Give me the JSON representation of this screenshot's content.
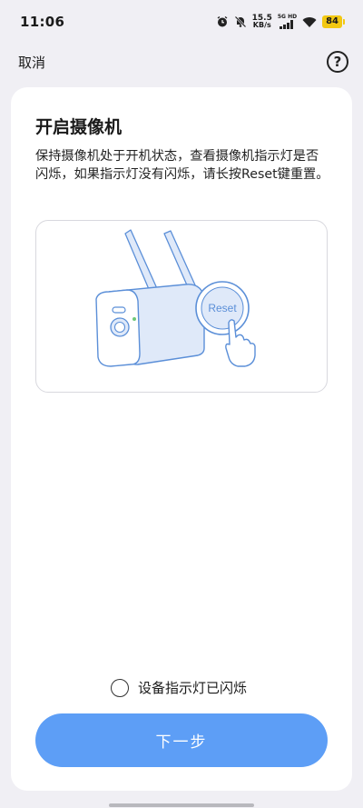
{
  "status_bar": {
    "time": "11:06",
    "net_speed_value": "15.5",
    "net_speed_unit": "KB/s",
    "signal_label": "5G HD",
    "battery": "84",
    "icons": [
      "alarm-icon",
      "mute-icon",
      "signal-icon",
      "wifi-icon",
      "battery-icon"
    ]
  },
  "topbar": {
    "cancel_label": "取消",
    "help_icon": "question-circle-icon",
    "help_glyph": "?"
  },
  "card": {
    "title": "开启摄像机",
    "description": "保持摄像机处于开机状态，查看摄像机指示灯是否闪烁，如果指示灯没有闪烁，请长按Reset键重置。",
    "illustration": {
      "icon": "camera-reset-illustration",
      "reset_text": "Reset"
    },
    "confirm_label": "设备指示灯已闪烁",
    "confirm_checked": false,
    "next_label": "下一步"
  },
  "colors": {
    "accent": "#5d9ef6",
    "background": "#f0eff4",
    "illustration_stroke": "#5b8fd8",
    "illustration_fill": "#dfe9f9"
  }
}
